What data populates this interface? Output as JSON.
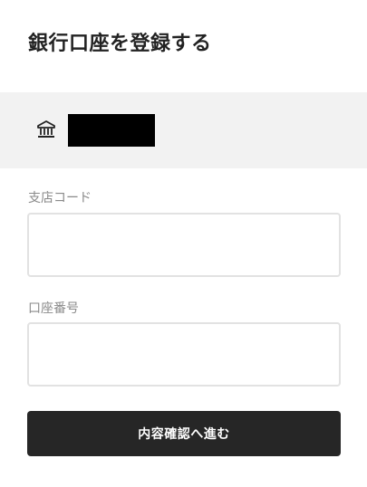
{
  "header": {
    "title": "銀行口座を登録する"
  },
  "bank": {
    "icon": "bank-icon",
    "name_redacted": true
  },
  "form": {
    "branch_code": {
      "label": "支店コード",
      "value": "",
      "placeholder": ""
    },
    "account_number": {
      "label": "口座番号",
      "value": "",
      "placeholder": ""
    },
    "submit_label": "内容確認へ進む"
  },
  "colors": {
    "background": "#ffffff",
    "bank_bar": "#f2f2f2",
    "label_text": "#8a8a8a",
    "field_border": "#e2e2e2",
    "button_bg": "#262626",
    "button_text": "#ffffff",
    "redaction": "#000000"
  }
}
